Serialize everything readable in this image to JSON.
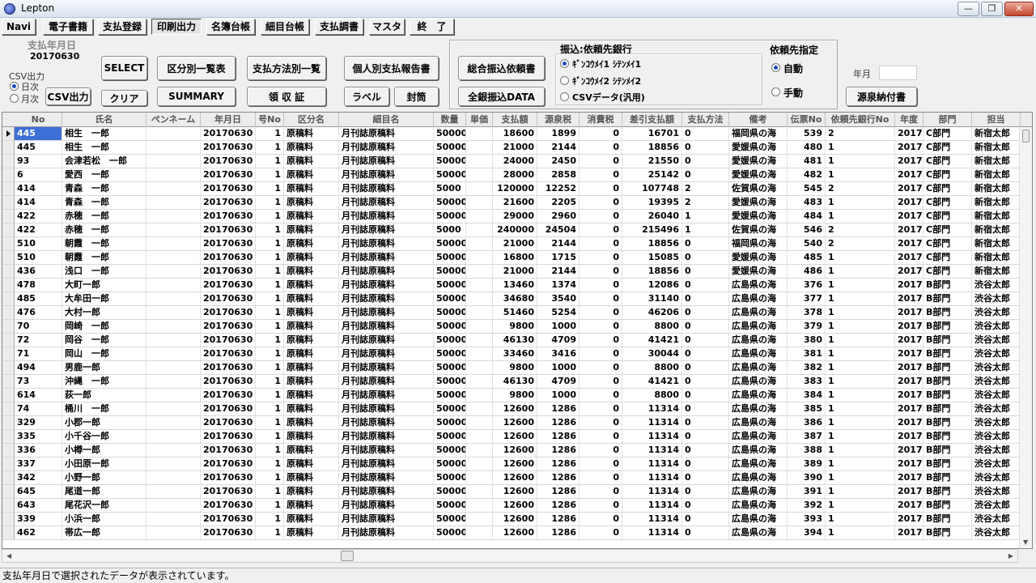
{
  "window": {
    "title": "Lepton",
    "min": "—",
    "max": "❐",
    "close": "✕"
  },
  "menu": [
    "Navi",
    "電子書籍",
    "支払登録",
    "印刷出力",
    "名簿台帳",
    "細目台帳",
    "支払調書",
    "マスタ",
    "終　了"
  ],
  "left": {
    "pay_date_label": "支払年月日",
    "pay_date_value": "20170630",
    "csv_label": "CSV出力",
    "radio_daily": "日次",
    "radio_monthly": "月次"
  },
  "buttons": {
    "select": "SELECT",
    "clear": "クリア",
    "csv": "CSV出力",
    "by_category": "区分別一覧表",
    "summary": "SUMMARY",
    "by_method": "支払方法別一覧",
    "receipt": "領 収 証",
    "individual": "個人別支払報告書",
    "label": "ラベル",
    "envelope": "封筒",
    "total_transfer": "総合振込依頼書",
    "zengin": "全銀振込DATA",
    "withholding": "源泉納付書"
  },
  "bank": {
    "title": "振込:依頼先銀行",
    "opt1": "ｷﾞﾝｺｳﾒｲ1 ｼﾃﾝﾒｲ1",
    "opt2": "ｷﾞﾝｺｳﾒｲ2 ｼﾃﾝﾒｲ2",
    "opt3": "CSVデータ(汎用)"
  },
  "dest": {
    "title": "依頼先指定",
    "auto": "自動",
    "manual": "手動"
  },
  "yearmonth_label": "年月",
  "columns": [
    "No",
    "氏名",
    "ペンネーム",
    "年月日",
    "号No",
    "区分名",
    "細目名",
    "数量",
    "単価",
    "支払額",
    "源泉税",
    "消費税",
    "差引支払額",
    "支払方法",
    "備考",
    "伝票No",
    "依頼先銀行No",
    "年度",
    "部門",
    "担当"
  ],
  "rows": [
    [
      "445",
      "相生　一郎",
      "",
      "20170630",
      "1",
      "原稿料",
      "月刊誌原稿料",
      "50000",
      "",
      "18600",
      "1899",
      "0",
      "16701",
      "0",
      "福岡県の海",
      "539",
      "2",
      "2017",
      "C部門",
      "新宿太郎"
    ],
    [
      "445",
      "相生　一郎",
      "",
      "20170630",
      "1",
      "原稿料",
      "月刊誌原稿料",
      "50000",
      "",
      "21000",
      "2144",
      "0",
      "18856",
      "0",
      "愛媛県の海",
      "480",
      "1",
      "2017",
      "C部門",
      "新宿太郎"
    ],
    [
      "93",
      "会津若松　一郎",
      "",
      "20170630",
      "1",
      "原稿料",
      "月刊誌原稿料",
      "50000",
      "",
      "24000",
      "2450",
      "0",
      "21550",
      "0",
      "愛媛県の海",
      "481",
      "1",
      "2017",
      "C部門",
      "新宿太郎"
    ],
    [
      "6",
      "愛西　一郎",
      "",
      "20170630",
      "1",
      "原稿料",
      "月刊誌原稿料",
      "50000",
      "",
      "28000",
      "2858",
      "0",
      "25142",
      "0",
      "愛媛県の海",
      "482",
      "1",
      "2017",
      "C部門",
      "新宿太郎"
    ],
    [
      "414",
      "青森　一郎",
      "",
      "20170630",
      "1",
      "原稿料",
      "月刊誌原稿料",
      "5000",
      "",
      "120000",
      "12252",
      "0",
      "107748",
      "2",
      "佐賀県の海",
      "545",
      "2",
      "2017",
      "C部門",
      "新宿太郎"
    ],
    [
      "414",
      "青森　一郎",
      "",
      "20170630",
      "1",
      "原稿料",
      "月刊誌原稿料",
      "50000",
      "",
      "21600",
      "2205",
      "0",
      "19395",
      "2",
      "愛媛県の海",
      "483",
      "1",
      "2017",
      "C部門",
      "新宿太郎"
    ],
    [
      "422",
      "赤穂　一郎",
      "",
      "20170630",
      "1",
      "原稿料",
      "月刊誌原稿料",
      "50000",
      "",
      "29000",
      "2960",
      "0",
      "26040",
      "1",
      "愛媛県の海",
      "484",
      "1",
      "2017",
      "C部門",
      "新宿太郎"
    ],
    [
      "422",
      "赤穂　一郎",
      "",
      "20170630",
      "1",
      "原稿料",
      "月刊誌原稿料",
      "5000",
      "",
      "240000",
      "24504",
      "0",
      "215496",
      "1",
      "佐賀県の海",
      "546",
      "2",
      "2017",
      "C部門",
      "新宿太郎"
    ],
    [
      "510",
      "朝霞　一郎",
      "",
      "20170630",
      "1",
      "原稿料",
      "月刊誌原稿料",
      "50000",
      "",
      "21000",
      "2144",
      "0",
      "18856",
      "0",
      "福岡県の海",
      "540",
      "2",
      "2017",
      "C部門",
      "新宿太郎"
    ],
    [
      "510",
      "朝霞　一郎",
      "",
      "20170630",
      "1",
      "原稿料",
      "月刊誌原稿料",
      "50000",
      "",
      "16800",
      "1715",
      "0",
      "15085",
      "0",
      "愛媛県の海",
      "485",
      "1",
      "2017",
      "C部門",
      "新宿太郎"
    ],
    [
      "436",
      "浅口　一郎",
      "",
      "20170630",
      "1",
      "原稿料",
      "月刊誌原稿料",
      "50000",
      "",
      "21000",
      "2144",
      "0",
      "18856",
      "0",
      "愛媛県の海",
      "486",
      "1",
      "2017",
      "C部門",
      "新宿太郎"
    ],
    [
      "478",
      "大町一郎",
      "",
      "20170630",
      "1",
      "原稿料",
      "月刊誌原稿料",
      "50000",
      "",
      "13460",
      "1374",
      "0",
      "12086",
      "0",
      "広島県の海",
      "376",
      "1",
      "2017",
      "B部門",
      "渋谷太郎"
    ],
    [
      "485",
      "大牟田一郎",
      "",
      "20170630",
      "1",
      "原稿料",
      "月刊誌原稿料",
      "50000",
      "",
      "34680",
      "3540",
      "0",
      "31140",
      "0",
      "広島県の海",
      "377",
      "1",
      "2017",
      "B部門",
      "渋谷太郎"
    ],
    [
      "476",
      "大村一郎",
      "",
      "20170630",
      "1",
      "原稿料",
      "月刊誌原稿料",
      "50000",
      "",
      "51460",
      "5254",
      "0",
      "46206",
      "0",
      "広島県の海",
      "378",
      "1",
      "2017",
      "B部門",
      "渋谷太郎"
    ],
    [
      "70",
      "岡崎　一郎",
      "",
      "20170630",
      "1",
      "原稿料",
      "月刊誌原稿料",
      "50000",
      "",
      "9800",
      "1000",
      "0",
      "8800",
      "0",
      "広島県の海",
      "379",
      "1",
      "2017",
      "B部門",
      "渋谷太郎"
    ],
    [
      "72",
      "岡谷　一郎",
      "",
      "20170630",
      "1",
      "原稿料",
      "月刊誌原稿料",
      "50000",
      "",
      "46130",
      "4709",
      "0",
      "41421",
      "0",
      "広島県の海",
      "380",
      "1",
      "2017",
      "B部門",
      "渋谷太郎"
    ],
    [
      "71",
      "岡山　一郎",
      "",
      "20170630",
      "1",
      "原稿料",
      "月刊誌原稿料",
      "50000",
      "",
      "33460",
      "3416",
      "0",
      "30044",
      "0",
      "広島県の海",
      "381",
      "1",
      "2017",
      "B部門",
      "渋谷太郎"
    ],
    [
      "494",
      "男鹿一郎",
      "",
      "20170630",
      "1",
      "原稿料",
      "月刊誌原稿料",
      "50000",
      "",
      "9800",
      "1000",
      "0",
      "8800",
      "0",
      "広島県の海",
      "382",
      "1",
      "2017",
      "B部門",
      "渋谷太郎"
    ],
    [
      "73",
      "沖縄　一郎",
      "",
      "20170630",
      "1",
      "原稿料",
      "月刊誌原稿料",
      "50000",
      "",
      "46130",
      "4709",
      "0",
      "41421",
      "0",
      "広島県の海",
      "383",
      "1",
      "2017",
      "B部門",
      "渋谷太郎"
    ],
    [
      "614",
      "荻一郎",
      "",
      "20170630",
      "1",
      "原稿料",
      "月刊誌原稿料",
      "50000",
      "",
      "9800",
      "1000",
      "0",
      "8800",
      "0",
      "広島県の海",
      "384",
      "1",
      "2017",
      "B部門",
      "渋谷太郎"
    ],
    [
      "74",
      "桶川　一郎",
      "",
      "20170630",
      "1",
      "原稿料",
      "月刊誌原稿料",
      "50000",
      "",
      "12600",
      "1286",
      "0",
      "11314",
      "0",
      "広島県の海",
      "385",
      "1",
      "2017",
      "B部門",
      "渋谷太郎"
    ],
    [
      "329",
      "小郡一郎",
      "",
      "20170630",
      "1",
      "原稿料",
      "月刊誌原稿料",
      "50000",
      "",
      "12600",
      "1286",
      "0",
      "11314",
      "0",
      "広島県の海",
      "386",
      "1",
      "2017",
      "B部門",
      "渋谷太郎"
    ],
    [
      "335",
      "小千谷一郎",
      "",
      "20170630",
      "1",
      "原稿料",
      "月刊誌原稿料",
      "50000",
      "",
      "12600",
      "1286",
      "0",
      "11314",
      "0",
      "広島県の海",
      "387",
      "1",
      "2017",
      "B部門",
      "渋谷太郎"
    ],
    [
      "336",
      "小樽一郎",
      "",
      "20170630",
      "1",
      "原稿料",
      "月刊誌原稿料",
      "50000",
      "",
      "12600",
      "1286",
      "0",
      "11314",
      "0",
      "広島県の海",
      "388",
      "1",
      "2017",
      "B部門",
      "渋谷太郎"
    ],
    [
      "337",
      "小田原一郎",
      "",
      "20170630",
      "1",
      "原稿料",
      "月刊誌原稿料",
      "50000",
      "",
      "12600",
      "1286",
      "0",
      "11314",
      "0",
      "広島県の海",
      "389",
      "1",
      "2017",
      "B部門",
      "渋谷太郎"
    ],
    [
      "342",
      "小野一郎",
      "",
      "20170630",
      "1",
      "原稿料",
      "月刊誌原稿料",
      "50000",
      "",
      "12600",
      "1286",
      "0",
      "11314",
      "0",
      "広島県の海",
      "390",
      "1",
      "2017",
      "B部門",
      "渋谷太郎"
    ],
    [
      "645",
      "尾道一郎",
      "",
      "20170630",
      "1",
      "原稿料",
      "月刊誌原稿料",
      "50000",
      "",
      "12600",
      "1286",
      "0",
      "11314",
      "0",
      "広島県の海",
      "391",
      "1",
      "2017",
      "B部門",
      "渋谷太郎"
    ],
    [
      "643",
      "尾花沢一郎",
      "",
      "20170630",
      "1",
      "原稿料",
      "月刊誌原稿料",
      "50000",
      "",
      "12600",
      "1286",
      "0",
      "11314",
      "0",
      "広島県の海",
      "392",
      "1",
      "2017",
      "B部門",
      "渋谷太郎"
    ],
    [
      "339",
      "小浜一郎",
      "",
      "20170630",
      "1",
      "原稿料",
      "月刊誌原稿料",
      "50000",
      "",
      "12600",
      "1286",
      "0",
      "11314",
      "0",
      "広島県の海",
      "393",
      "1",
      "2017",
      "B部門",
      "渋谷太郎"
    ],
    [
      "462",
      "帯広一郎",
      "",
      "20170630",
      "1",
      "原稿料",
      "月刊誌原稿料",
      "50000",
      "",
      "12600",
      "1286",
      "0",
      "11314",
      "0",
      "広島県の海",
      "394",
      "1",
      "2017",
      "B部門",
      "渋谷太郎"
    ]
  ],
  "status": "支払年月日で選択されたデータが表示されています。"
}
